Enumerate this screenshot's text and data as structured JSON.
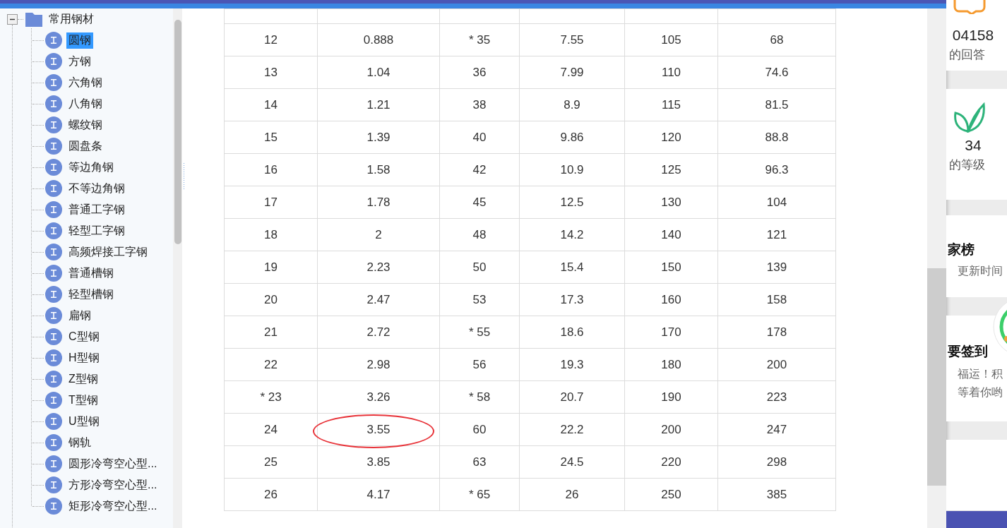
{
  "tree": {
    "items": [
      {
        "label": "常用钢材",
        "expanded": true,
        "children": [
          {
            "label": "圆钢",
            "selected": true
          },
          {
            "label": "方钢",
            "selected": false
          },
          {
            "label": "六角钢",
            "selected": false
          },
          {
            "label": "八角钢",
            "selected": false
          },
          {
            "label": "螺纹钢",
            "selected": false
          },
          {
            "label": "圆盘条",
            "selected": false
          },
          {
            "label": "等边角钢",
            "selected": false
          },
          {
            "label": "不等边角钢",
            "selected": false
          },
          {
            "label": "普通工字钢",
            "selected": false
          },
          {
            "label": "轻型工字钢",
            "selected": false
          },
          {
            "label": "高频焊接工字钢",
            "selected": false
          },
          {
            "label": "普通槽钢",
            "selected": false
          },
          {
            "label": "轻型槽钢",
            "selected": false
          },
          {
            "label": "扁钢",
            "selected": false
          },
          {
            "label": "C型钢",
            "selected": false
          },
          {
            "label": "H型钢",
            "selected": false
          },
          {
            "label": "Z型钢",
            "selected": false
          },
          {
            "label": "T型钢",
            "selected": false
          },
          {
            "label": "U型钢",
            "selected": false
          },
          {
            "label": "钢轨",
            "selected": false
          },
          {
            "label": "圆形冷弯空心型...",
            "selected": false
          },
          {
            "label": "方形冷弯空心型...",
            "selected": false
          },
          {
            "label": "矩形冷弯空心型...",
            "selected": false
          }
        ]
      }
    ]
  },
  "table": {
    "rows": [
      {
        "cells": [
          "12",
          "0.888",
          "* 35",
          "7.55",
          "105",
          "68"
        ],
        "circled": false
      },
      {
        "cells": [
          "13",
          "1.04",
          "36",
          "7.99",
          "110",
          "74.6"
        ],
        "circled": false
      },
      {
        "cells": [
          "14",
          "1.21",
          "38",
          "8.9",
          "115",
          "81.5"
        ],
        "circled": false
      },
      {
        "cells": [
          "15",
          "1.39",
          "40",
          "9.86",
          "120",
          "88.8"
        ],
        "circled": false
      },
      {
        "cells": [
          "16",
          "1.58",
          "42",
          "10.9",
          "125",
          "96.3"
        ],
        "circled": false
      },
      {
        "cells": [
          "17",
          "1.78",
          "45",
          "12.5",
          "130",
          "104"
        ],
        "circled": false
      },
      {
        "cells": [
          "18",
          "2",
          "48",
          "14.2",
          "140",
          "121"
        ],
        "circled": false
      },
      {
        "cells": [
          "19",
          "2.23",
          "50",
          "15.4",
          "150",
          "139"
        ],
        "circled": false
      },
      {
        "cells": [
          "20",
          "2.47",
          "53",
          "17.3",
          "160",
          "158"
        ],
        "circled": false
      },
      {
        "cells": [
          "21",
          "2.72",
          "* 55",
          "18.6",
          "170",
          "178"
        ],
        "circled": false
      },
      {
        "cells": [
          "22",
          "2.98",
          "56",
          "19.3",
          "180",
          "200"
        ],
        "circled": false
      },
      {
        "cells": [
          "* 23",
          "3.26",
          "* 58",
          "20.7",
          "190",
          "223"
        ],
        "circled": false
      },
      {
        "cells": [
          "24",
          "3.55",
          "60",
          "22.2",
          "200",
          "247"
        ],
        "circled": true
      },
      {
        "cells": [
          "25",
          "3.85",
          "63",
          "24.5",
          "220",
          "298"
        ],
        "circled": false
      },
      {
        "cells": [
          "26",
          "4.17",
          "* 65",
          "26",
          "250",
          "385"
        ],
        "circled": false
      }
    ]
  },
  "side_panel": {
    "answers": {
      "count": "04158",
      "label": "的回答"
    },
    "level": {
      "count": "34",
      "label": "的等级"
    },
    "ranking": {
      "title": "家榜",
      "subtitle": "更新时间"
    },
    "sign_in": {
      "title": "要签到",
      "lines": [
        "福运！积",
        "等着你哟"
      ]
    }
  }
}
